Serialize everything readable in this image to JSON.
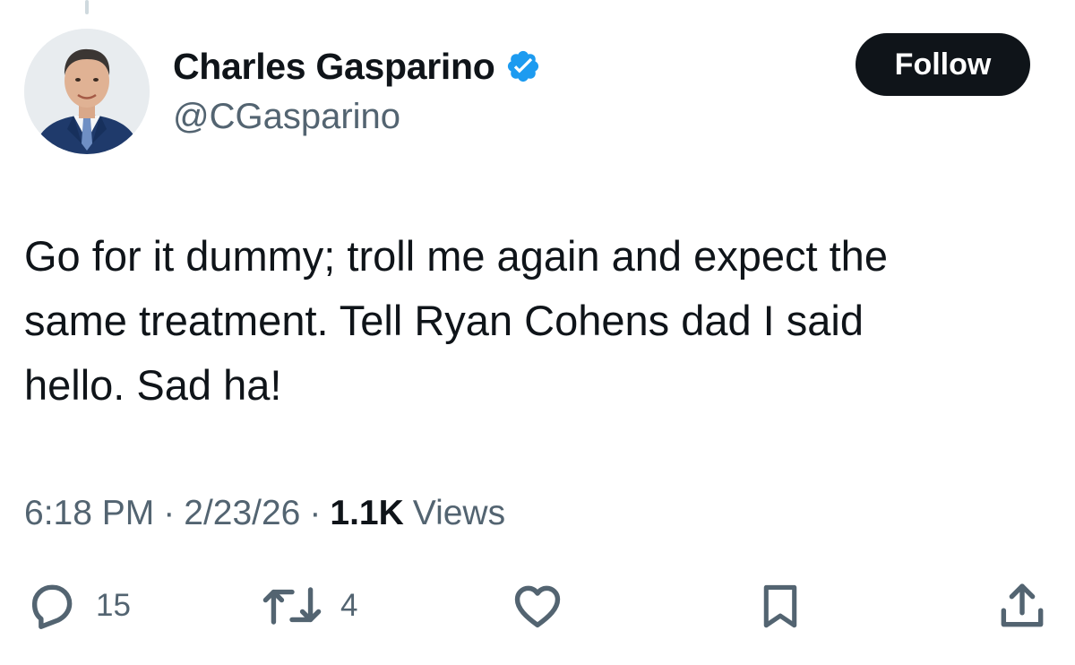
{
  "author": {
    "display_name": "Charles Gasparino",
    "handle": "@CGasparino",
    "verified": true,
    "verified_color": "#1d9bf0"
  },
  "follow_button": {
    "label": "Follow"
  },
  "tweet": {
    "lines": [
      "Go for it dummy; troll me again and expect the",
      "same treatment. Tell Ryan Cohens dad I said",
      "hello. Sad ha!"
    ]
  },
  "meta": {
    "time": "6:18 PM",
    "separator": "·",
    "date": "2/23/26",
    "views_count": "1.1K",
    "views_label": "Views"
  },
  "actions": {
    "reply": {
      "icon": "reply-icon",
      "count": "15"
    },
    "repost": {
      "icon": "repost-icon",
      "count": "4"
    },
    "like": {
      "icon": "heart-icon"
    },
    "bookmark": {
      "icon": "bookmark-icon"
    },
    "share": {
      "icon": "share-icon"
    }
  },
  "colors": {
    "text": "#0f1419",
    "secondary": "#536471",
    "follow_bg": "#0f1419",
    "follow_text": "#ffffff"
  }
}
